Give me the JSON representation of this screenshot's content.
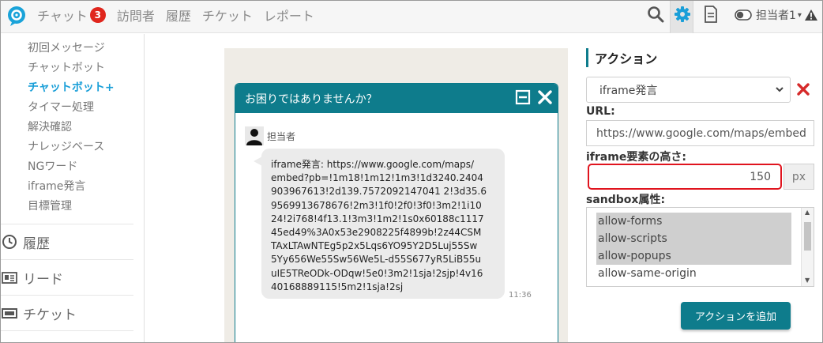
{
  "header": {
    "nav": [
      {
        "label": "チャット",
        "badge": "3"
      },
      {
        "label": "訪問者"
      },
      {
        "label": "履歴"
      },
      {
        "label": "チケット"
      },
      {
        "label": "レポート"
      }
    ],
    "user": "担当者1"
  },
  "sidebar": {
    "sub_items": [
      "初回メッセージ",
      "チャットボット",
      "チャットボット+",
      "タイマー処理",
      "解決確認",
      "ナレッジベース",
      "NGワード",
      "iframe発言",
      "目標管理"
    ],
    "main_items": [
      "履歴",
      "リード",
      "チケット"
    ]
  },
  "chat_preview": {
    "title": "お困りではありませんか？",
    "agent_name": "担当者",
    "message": "iframe発言: https://www.google.com/maps/\nembed?pb=!1m18!1m12!1m3!1d3240.2404\n903967613!2d139.7572092147041 2!3d35.6\n9569913678676!2m3!1f0!2f0!3f0!3m2!1i10\n24!2i768!4f13.1!3m3!1m2!1s0x60188c1117\n45ed49%3A0x53e2908225f4899b!2z44CSM\nTAxLTAwNTEg5p2x5Lqs6YO95Y2D5Luj55Sw\n5Yy656We55Sw56We5L-d55S677yR5LiB55u\nuIE5TReODk-ODqw!5e0!3m2!1sja!2sjp!4v16\n40168889115!5m2!1sja!2sj",
    "time": "11:36"
  },
  "action_panel": {
    "title": "アクション",
    "action_type": "iframe発言",
    "url_label": "URL:",
    "url_value": "https://www.google.com/maps/embed",
    "height_label": "iframe要素の高さ:",
    "height_value": "150",
    "height_unit": "px",
    "sandbox_label": "sandbox属性:",
    "sandbox_options": [
      {
        "label": "allow-forms",
        "selected": true
      },
      {
        "label": "allow-scripts",
        "selected": true
      },
      {
        "label": "allow-popups",
        "selected": true
      },
      {
        "label": "allow-same-origin",
        "selected": false
      }
    ],
    "add_button": "アクションを追加"
  },
  "colors": {
    "accent": "#0e7c8c",
    "link": "#1a9fd8",
    "alert": "#e0261d"
  }
}
